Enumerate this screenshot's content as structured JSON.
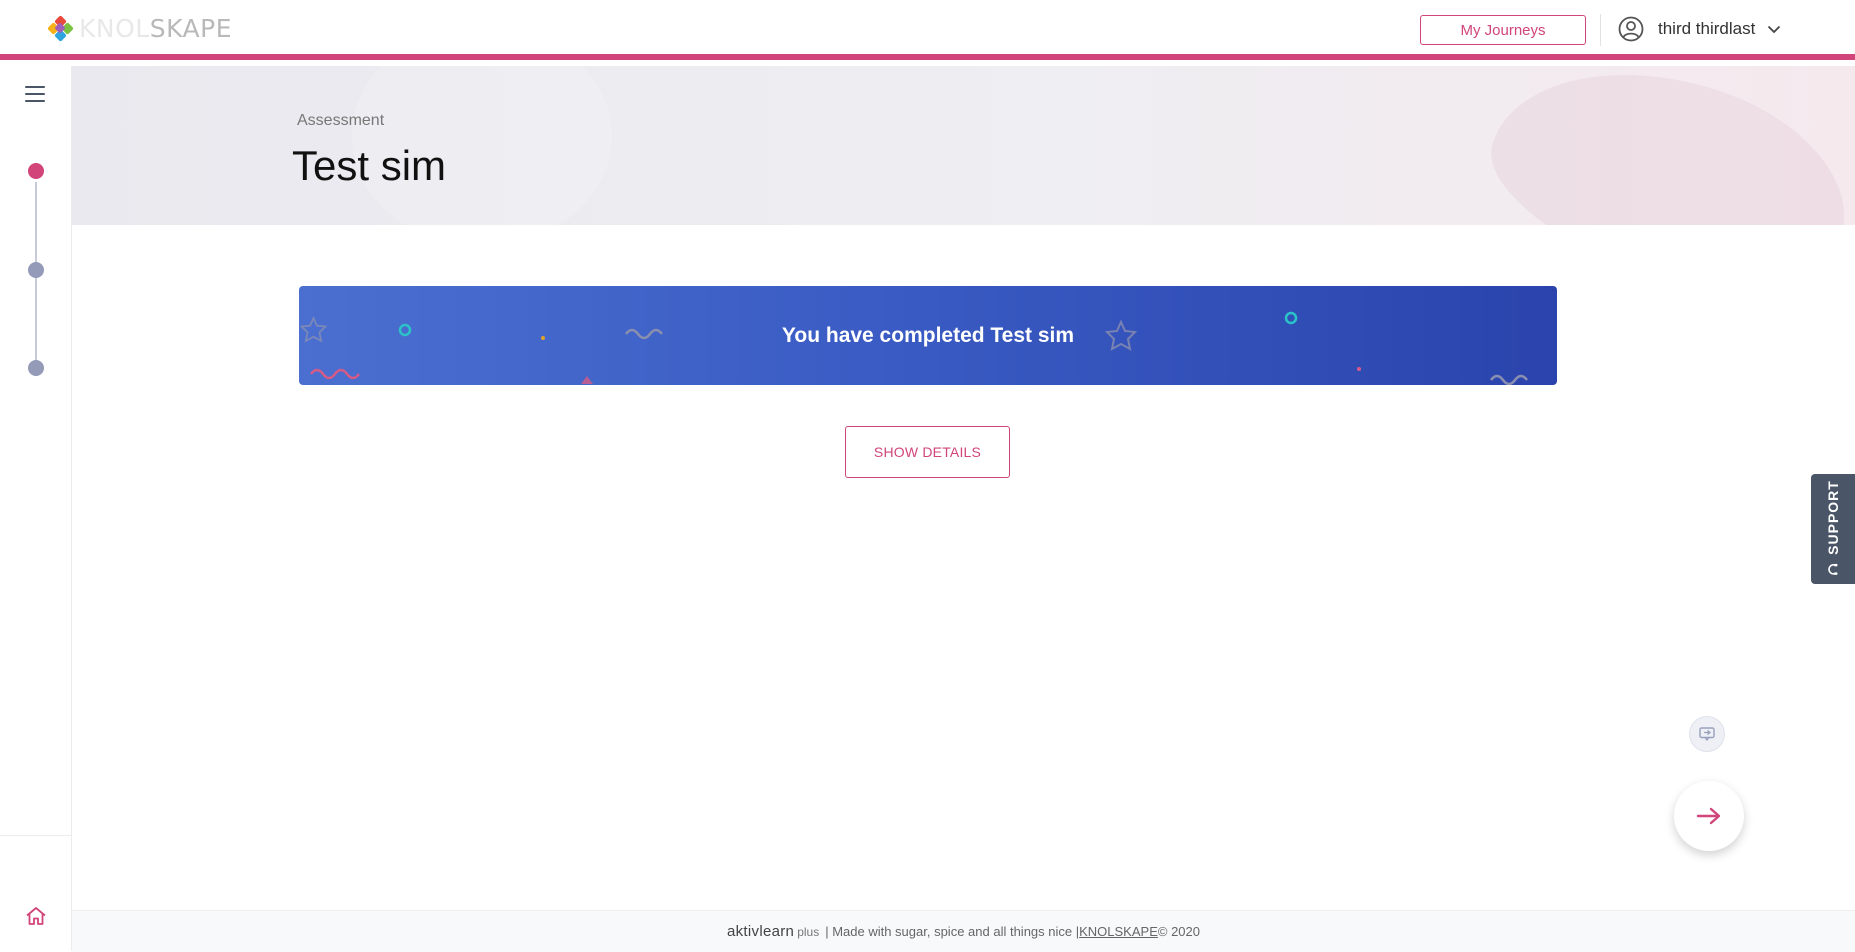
{
  "header": {
    "logo_text_light": "KNOL",
    "logo_text_dark": "SKAPE",
    "journeys_label": "My Journeys",
    "user_name": "third thirdlast"
  },
  "sidebar": {
    "steps": [
      {
        "state": "active"
      },
      {
        "state": "pending"
      },
      {
        "state": "pending"
      }
    ]
  },
  "hero": {
    "breadcrumb": "Assessment",
    "title": "Test sim"
  },
  "banner": {
    "message": "You have completed Test sim"
  },
  "actions": {
    "show_details_label": "SHOW DETAILS"
  },
  "support": {
    "label": "SUPPORT"
  },
  "footer": {
    "brand": "aktivlearn",
    "brand_suffix": "plus",
    "tagline": " | Made with sugar, spice and all things nice | ",
    "company_link": "KNOLSKAPE",
    "copyright": " © 2020"
  },
  "colors": {
    "accent": "#d1457a",
    "banner_start": "#4a6fd0",
    "banner_end": "#2b44ad",
    "sidebar_dot": "#939bb8",
    "support_bg": "#4a5568"
  },
  "icons": [
    "logo-icon",
    "user-avatar-icon",
    "chevron-down-icon",
    "hamburger-menu-icon",
    "home-icon",
    "support-headset-icon",
    "chat-icon",
    "arrow-right-icon"
  ]
}
